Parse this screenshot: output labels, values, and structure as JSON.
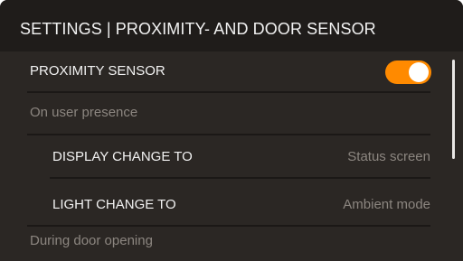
{
  "header": {
    "title": "SETTINGS | PROXIMITY- AND DOOR SENSOR"
  },
  "settings": {
    "proximity_sensor": {
      "label": "PROXIMITY SENSOR",
      "toggle_on": true
    },
    "section_user_presence": "On user presence",
    "display_change": {
      "label": "DISPLAY CHANGE TO",
      "value": "Status screen"
    },
    "light_change": {
      "label": "LIGHT CHANGE TO",
      "value": "Ambient mode"
    },
    "section_door_opening": "During door opening"
  },
  "colors": {
    "accent": "#ff8a00",
    "background": "#2b2724",
    "header_background": "#1f1c1a",
    "primary_text": "#f2f2f2",
    "secondary_text": "#8c8680"
  }
}
